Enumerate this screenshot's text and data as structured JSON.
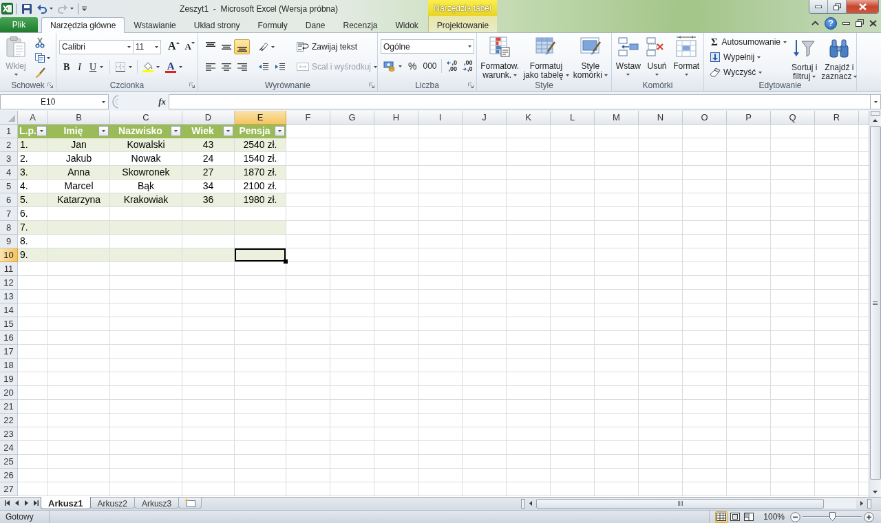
{
  "title_bar": {
    "quick_access": [
      {
        "kind": "save",
        "disabled": false
      },
      {
        "kind": "undo",
        "disabled": false
      },
      {
        "kind": "redo",
        "disabled": true
      }
    ],
    "title": "Zeszyt1  -  Microsoft Excel (Wersja próbna)",
    "context_group": "Narzędzia tabel"
  },
  "ribbon_tabs": [
    {
      "label": "Plik",
      "kind": "file",
      "selected": false
    },
    {
      "label": "Narzędzia główne",
      "kind": "tab",
      "selected": true
    },
    {
      "label": "Wstawianie",
      "kind": "tab",
      "selected": false
    },
    {
      "label": "Układ strony",
      "kind": "tab",
      "selected": false
    },
    {
      "label": "Formuły",
      "kind": "tab",
      "selected": false
    },
    {
      "label": "Dane",
      "kind": "tab",
      "selected": false
    },
    {
      "label": "Recenzja",
      "kind": "tab",
      "selected": false
    },
    {
      "label": "Widok",
      "kind": "tab",
      "selected": false
    },
    {
      "label": "Projektowanie",
      "kind": "contextual",
      "selected": false
    }
  ],
  "ribbon_controls": {
    "help": "?"
  },
  "ribbon": {
    "clipboard": {
      "label": "Schowek",
      "paste": {
        "label": "Wklej",
        "disabled": true
      }
    },
    "font": {
      "label": "Czcionka",
      "font_name": "Calibri",
      "font_size": "11",
      "grow": "A",
      "shrink": "A",
      "bold": "B",
      "italic": "I",
      "underline": "U",
      "font_color": "A"
    },
    "alignment": {
      "label": "Wyrównanie",
      "vertical": [
        {
          "kind": "top",
          "selected": false
        },
        {
          "kind": "middle",
          "selected": false
        },
        {
          "kind": "bottom",
          "selected": true
        }
      ],
      "horizontal": [
        {
          "kind": "left",
          "selected": false
        },
        {
          "kind": "center",
          "selected": false
        },
        {
          "kind": "right",
          "selected": false
        }
      ],
      "wrap_text": "Zawijaj tekst",
      "merge": {
        "label": "Scal i wyśrodkuj",
        "disabled": true
      }
    },
    "number": {
      "label": "Liczba",
      "format": "Ogólne",
      "percent": "%",
      "thousands": "000",
      "increase_decimal": [
        ",0",
        ",00"
      ],
      "decrease_decimal": [
        ",00",
        ",0"
      ]
    },
    "styles": {
      "label": "Style",
      "buttons": [
        {
          "kind": "conditional",
          "lines": [
            "Formatow.",
            "warunk."
          ]
        },
        {
          "kind": "table",
          "lines": [
            "Formatuj",
            "jako tabelę"
          ]
        },
        {
          "kind": "cell_styles",
          "lines": [
            "Style",
            "komórki"
          ]
        }
      ]
    },
    "cells": {
      "label": "Komórki",
      "buttons": [
        {
          "kind": "insert",
          "label": "Wstaw"
        },
        {
          "kind": "delete",
          "label": "Usuń"
        },
        {
          "kind": "format",
          "label": "Format"
        }
      ]
    },
    "editing": {
      "label": "Edytowanie",
      "autosum_symbol": "Σ",
      "autosum": "Autosumowanie",
      "fill": "Wypełnij",
      "clear": "Wyczyść",
      "sort": [
        "Sortuj i",
        "filtruj"
      ],
      "find": [
        "Znajdź i",
        "zaznacz"
      ]
    }
  },
  "formula_bar": {
    "name_box": "E10",
    "function_label": "fx"
  },
  "sheet": {
    "columns": [
      {
        "label": "A",
        "selected": false
      },
      {
        "label": "B",
        "selected": false
      },
      {
        "label": "C",
        "selected": false
      },
      {
        "label": "D",
        "selected": false
      },
      {
        "label": "E",
        "selected": true
      },
      {
        "label": "F",
        "selected": false
      },
      {
        "label": "G",
        "selected": false
      },
      {
        "label": "H",
        "selected": false
      },
      {
        "label": "I",
        "selected": false
      },
      {
        "label": "J",
        "selected": false
      },
      {
        "label": "K",
        "selected": false
      },
      {
        "label": "L",
        "selected": false
      },
      {
        "label": "M",
        "selected": false
      },
      {
        "label": "N",
        "selected": false
      },
      {
        "label": "O",
        "selected": false
      },
      {
        "label": "P",
        "selected": false
      },
      {
        "label": "Q",
        "selected": false
      },
      {
        "label": "R",
        "selected": false
      }
    ],
    "rows": [
      {
        "label": "1",
        "selected": false
      },
      {
        "label": "2",
        "selected": false
      },
      {
        "label": "3",
        "selected": false
      },
      {
        "label": "4",
        "selected": false
      },
      {
        "label": "5",
        "selected": false
      },
      {
        "label": "6",
        "selected": false
      },
      {
        "label": "7",
        "selected": false
      },
      {
        "label": "8",
        "selected": false
      },
      {
        "label": "9",
        "selected": false
      },
      {
        "label": "10",
        "selected": true
      },
      {
        "label": "11",
        "selected": false
      },
      {
        "label": "12",
        "selected": false
      },
      {
        "label": "13",
        "selected": false
      },
      {
        "label": "14",
        "selected": false
      },
      {
        "label": "15",
        "selected": false
      },
      {
        "label": "16",
        "selected": false
      },
      {
        "label": "17",
        "selected": false
      },
      {
        "label": "18",
        "selected": false
      },
      {
        "label": "19",
        "selected": false
      },
      {
        "label": "20",
        "selected": false
      },
      {
        "label": "21",
        "selected": false
      },
      {
        "label": "22",
        "selected": false
      },
      {
        "label": "23",
        "selected": false
      },
      {
        "label": "24",
        "selected": false
      },
      {
        "label": "25",
        "selected": false
      },
      {
        "label": "26",
        "selected": false
      },
      {
        "label": "27",
        "selected": false
      }
    ],
    "table": {
      "header": [
        "L.p.",
        "Imię",
        "Nazwisko",
        "Wiek",
        "Pensja"
      ],
      "rows": [
        {
          "cells": [
            {
              "text": "1.",
              "selected": false
            },
            {
              "text": "Jan",
              "selected": false
            },
            {
              "text": "Kowalski",
              "selected": false
            },
            {
              "text": "43",
              "selected": false
            },
            {
              "text": "2540 zł.",
              "selected": false
            }
          ]
        },
        {
          "cells": [
            {
              "text": "2.",
              "selected": false
            },
            {
              "text": "Jakub",
              "selected": false
            },
            {
              "text": "Nowak",
              "selected": false
            },
            {
              "text": "24",
              "selected": false
            },
            {
              "text": "1540 zł.",
              "selected": false
            }
          ]
        },
        {
          "cells": [
            {
              "text": "3.",
              "selected": false
            },
            {
              "text": "Anna",
              "selected": false
            },
            {
              "text": "Skowronek",
              "selected": false
            },
            {
              "text": "27",
              "selected": false
            },
            {
              "text": "1870 zł.",
              "selected": false
            }
          ]
        },
        {
          "cells": [
            {
              "text": "4.",
              "selected": false
            },
            {
              "text": "Marcel",
              "selected": false
            },
            {
              "text": "Bąk",
              "selected": false
            },
            {
              "text": "34",
              "selected": false
            },
            {
              "text": "2100 zł.",
              "selected": false
            }
          ]
        },
        {
          "cells": [
            {
              "text": "5.",
              "selected": false
            },
            {
              "text": "Katarzyna",
              "selected": false
            },
            {
              "text": "Krakowiak",
              "selected": false
            },
            {
              "text": "36",
              "selected": false
            },
            {
              "text": "1980 zł.",
              "selected": false
            }
          ]
        },
        {
          "cells": [
            {
              "text": "6.",
              "selected": false
            },
            {
              "selected": false
            },
            {
              "selected": false
            },
            {
              "selected": false
            },
            {
              "selected": false
            }
          ]
        },
        {
          "cells": [
            {
              "text": "7.",
              "selected": false
            },
            {
              "selected": false
            },
            {
              "selected": false
            },
            {
              "selected": false
            },
            {
              "selected": false
            }
          ]
        },
        {
          "cells": [
            {
              "text": "8.",
              "selected": false
            },
            {
              "selected": false
            },
            {
              "selected": false
            },
            {
              "selected": false
            },
            {
              "selected": false
            }
          ]
        },
        {
          "cells": [
            {
              "text": "9.",
              "selected": false
            },
            {
              "selected": false
            },
            {
              "selected": false
            },
            {
              "selected": false
            },
            {
              "selected": true
            }
          ]
        }
      ]
    }
  },
  "sheet_tabs": [
    {
      "label": "Arkusz1",
      "selected": true
    },
    {
      "label": "Arkusz2",
      "selected": false
    },
    {
      "label": "Arkusz3",
      "selected": false
    }
  ],
  "status_bar": {
    "status": "Gotowy",
    "views": [
      {
        "kind": "normal",
        "selected": true
      },
      {
        "kind": "page_layout",
        "selected": false
      },
      {
        "kind": "page_break",
        "selected": false
      }
    ],
    "zoom": "100%",
    "zoom_slider": {
      "level": 0.5
    }
  }
}
